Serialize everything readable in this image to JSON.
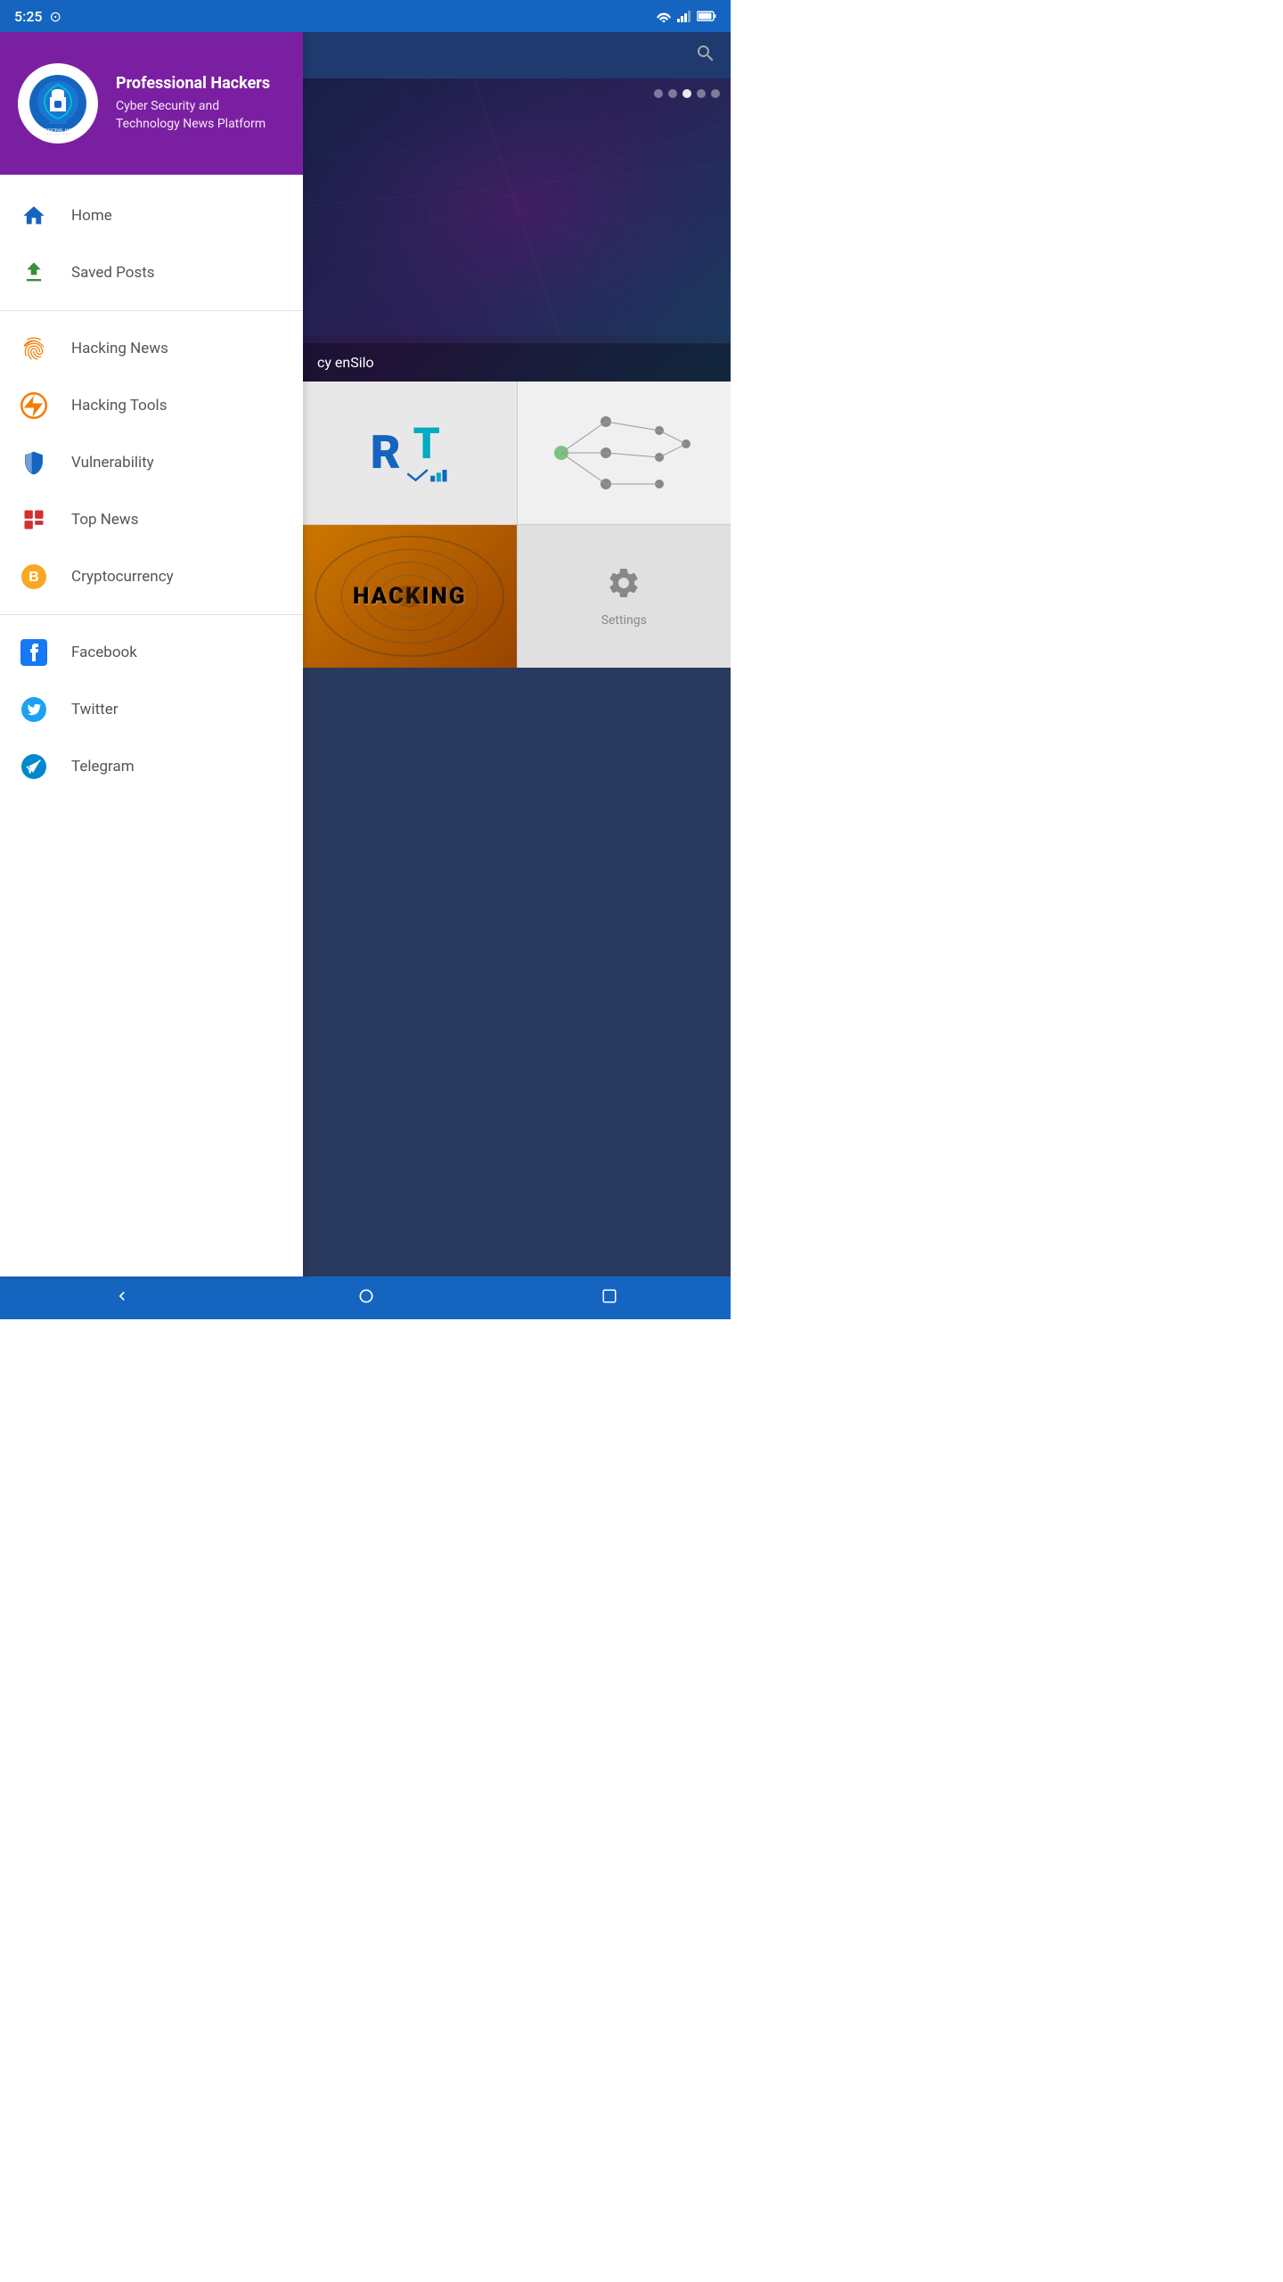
{
  "statusBar": {
    "time": "5:25",
    "wifiIcon": "wifi",
    "signalIcon": "signal",
    "batteryIcon": "battery"
  },
  "sidebar": {
    "header": {
      "appName": "Professional Hackers",
      "subtitle": "Cyber Security and Technology News Platform"
    },
    "menuGroups": [
      {
        "items": [
          {
            "id": "home",
            "label": "Home",
            "icon": "home",
            "color": "#1565C0"
          },
          {
            "id": "saved-posts",
            "label": "Saved Posts",
            "icon": "download",
            "color": "#388E3C"
          }
        ]
      },
      {
        "items": [
          {
            "id": "hacking-news",
            "label": "Hacking News",
            "icon": "fingerprint",
            "color": "#F57C00"
          },
          {
            "id": "hacking-tools",
            "label": "Hacking Tools",
            "icon": "flash",
            "color": "#F57C00"
          },
          {
            "id": "vulnerability",
            "label": "Vulnerability",
            "icon": "shield",
            "color": "#1565C0"
          },
          {
            "id": "top-news",
            "label": "Top News",
            "icon": "grid",
            "color": "#D32F2F"
          },
          {
            "id": "cryptocurrency",
            "label": "Cryptocurrency",
            "icon": "bitcoin",
            "color": "#F9A825"
          }
        ]
      },
      {
        "items": [
          {
            "id": "facebook",
            "label": "Facebook",
            "icon": "facebook",
            "color": "#1877F2"
          },
          {
            "id": "twitter",
            "label": "Twitter",
            "icon": "twitter",
            "color": "#1DA1F2"
          },
          {
            "id": "telegram",
            "label": "Telegram",
            "icon": "telegram",
            "color": "#0088cc"
          }
        ]
      }
    ]
  },
  "content": {
    "searchPlaceholder": "Search",
    "sliderText": "cy enSilo",
    "sliderDots": [
      false,
      false,
      true,
      false,
      false
    ],
    "cards": [
      {
        "id": "rt-logo",
        "type": "logo"
      },
      {
        "id": "diagram",
        "type": "diagram"
      },
      {
        "id": "hacking",
        "type": "hack",
        "text": "HACKING"
      },
      {
        "id": "settings",
        "type": "settings",
        "label": "Settings"
      }
    ]
  },
  "navBar": {
    "backLabel": "◀",
    "homeLabel": "●",
    "recentsLabel": "■"
  }
}
